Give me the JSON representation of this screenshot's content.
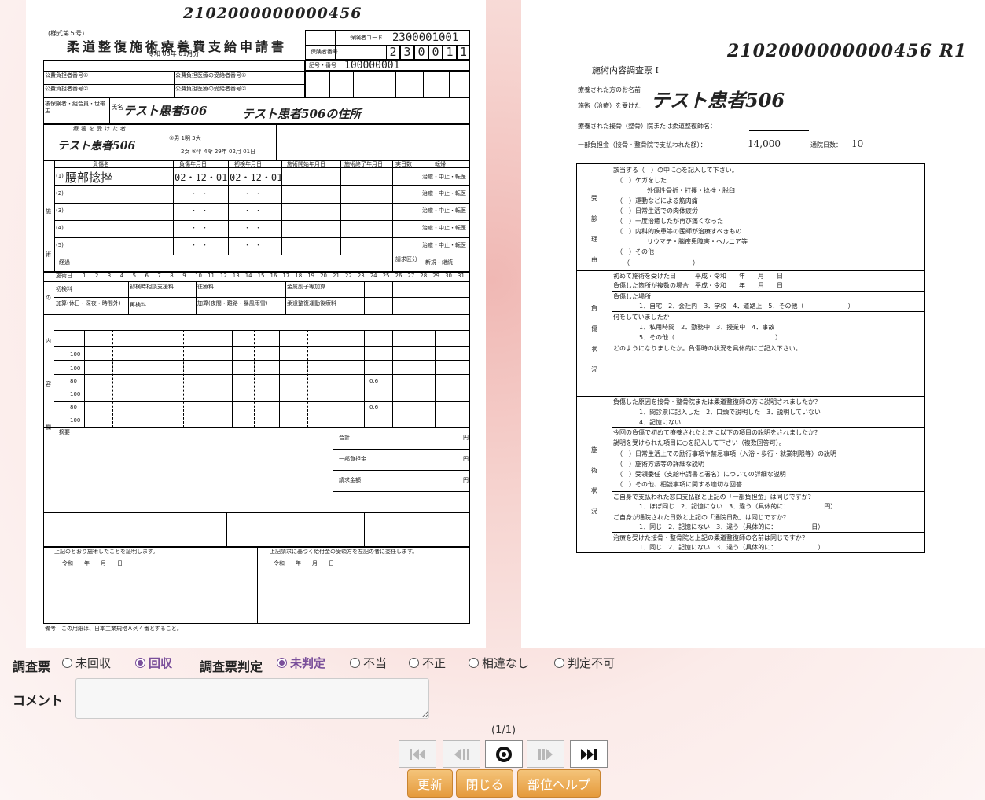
{
  "left_form": {
    "id_number": "2102000000000456",
    "form_no": "(様式第５号)",
    "title": "柔道整復施術療養費支給申請書",
    "era_date": "令和 03年 01月分",
    "insurer_code_label": "保険者コード",
    "insurer_code": "2300001001",
    "insurer_no_label": "保険者番号",
    "insurer_digits": [
      "2",
      "3",
      "0",
      "0",
      "1",
      "1"
    ],
    "symbol_number_label": "記号・番号",
    "symbol_number": "100000001",
    "public1_label": "公費負担者番号①",
    "public2_label": "公費負担者番号②",
    "recipient1_label": "公費負担医療の受給者番号①",
    "recipient2_label": "公費負担医療の受給者番号②",
    "insured_label": "被保険者・組合員・世帯主",
    "name_label": "氏名",
    "insured_name": "テスト患者506",
    "address_value": "テスト患者506の住所",
    "address_label": "住所",
    "patient_label": "療養を受けた者",
    "patient_name": "テスト患者506",
    "sex_label": "②男 1明 3大",
    "birth_text": "2女 ⑤平 4令 29年 02月 01日",
    "injury_header": [
      "負傷名",
      "負傷年月日",
      "初検年月日",
      "施術開始年月日",
      "施術終了年月日",
      "実日数",
      "転帰"
    ],
    "injury_rows": [
      {
        "no": "(1)",
        "name": "腰部捻挫",
        "injury_date": "02・12・01",
        "first_date": "02・12・01",
        "outcome": "治癒・中止・転医"
      },
      {
        "no": "(2)",
        "name": "",
        "injury_date": "・　・",
        "first_date": "・　・",
        "outcome": "治癒・中止・転医"
      },
      {
        "no": "(3)",
        "name": "",
        "injury_date": "・　・",
        "first_date": "・　・",
        "outcome": "治癒・中止・転医"
      },
      {
        "no": "(4)",
        "name": "",
        "injury_date": "・　・",
        "first_date": "・　・",
        "outcome": "治癒・中止・転医"
      },
      {
        "no": "(5)",
        "name": "",
        "injury_date": "・　・",
        "first_date": "・　・",
        "outcome": "治癒・中止・転医"
      }
    ],
    "progress_label": "経過",
    "claim_type_label": "請求区分",
    "claim_type_value": "新規・継続",
    "side_labels": [
      "施",
      "術",
      "の",
      "内",
      "容",
      "欄"
    ],
    "day_label": "施術日",
    "days": [
      "1",
      "2",
      "3",
      "4",
      "5",
      "6",
      "7",
      "8",
      "9",
      "10",
      "11",
      "12",
      "13",
      "14",
      "15",
      "16",
      "17",
      "18",
      "19",
      "20",
      "21",
      "22",
      "23",
      "24",
      "25",
      "26",
      "27",
      "28",
      "29",
      "30",
      "31"
    ],
    "fee_labels": [
      "初検料",
      "初検時相談支援料",
      "往療料",
      "金属副子等加算",
      "加算(休日・深夜・時間外)",
      "再検料",
      "加算(夜間・難路・暴風雨雪)",
      "柔道整復運動後療料"
    ],
    "unit": "円",
    "total_label": "合計",
    "copay_label": "一部負担金",
    "claim_amount_label": "請求金額",
    "summary_label": "摘要",
    "pct_values": [
      "100",
      "100",
      "80",
      "100",
      "80",
      "100"
    ],
    "multi_values": [
      "0.6",
      "0.6"
    ],
    "declaration": "上記のとおり施術したことを証明します。",
    "date_line": "令和　　年　　月　　日",
    "proxy_text": "上記請求に基づく給付金の受領方を左記の者に委任します。",
    "footer": "備考　この用紙は、日本工業規格Ａ列４番とすること。"
  },
  "right_form": {
    "id_number": "2102000000000456 R1",
    "title": "施術内容調査票 I",
    "patient_name_label": "療養された方のお名前",
    "treatment_label": "施術（治療）を受けた",
    "patient_name": "テスト患者506",
    "clinic_label": "療養された接骨（整骨）院または柔道整復師名：",
    "copay_label": "一部負担金（接骨・整骨院で支払われた額）：",
    "copay_value": "14,000",
    "visits_label": "通院日数：",
    "visits_value": "10",
    "section_reason": "受診理由",
    "section_injury": "負傷状況",
    "section_treat": "施術状況",
    "reason_lines": [
      "該当する（　）の中に○を記入して下さい。",
      "（　）ケガをした",
      "外傷性骨折・打撲・捻挫・脱臼",
      "（　）運動などによる筋肉痛",
      "（　）日常生活での肉体疲労",
      "（　）一度治癒したが再び痛くなった",
      "（　）内科的疾患等の医師が治療すべきもの",
      "リウマチ・脳疾患障害・ヘルニア等",
      "（　）その他",
      "（　　　　　　　　　　）"
    ],
    "injury_lines": [
      "初めて施術を受けた日　　　平成・令和　　年　　月　　日",
      "負傷した箇所が複数の場合　平成・令和　　年　　月　　日",
      "負傷した場所",
      "1．自宅　2．会社内　3．学校　4．道路上　5．その他（　　　　　　　）",
      "何をしていましたか",
      "1．私用時間　2．勤務中　3．授業中　4．事故",
      "5．その他（　　　　　　　　　　　　　　　　）",
      "どのようになりましたか。負傷時の状況を具体的にご記入下さい。"
    ],
    "treat_lines": [
      "負傷した原因を接骨・整骨院または柔道整復師の方に説明されましたか？",
      "1．問診票に記入した　2．口頭で説明した　3．説明していない",
      "4．記憶にない",
      "今回の負傷で初めて療養されたときに以下の項目の説明をされましたか？",
      "説明を受けられた項目に○を記入して下さい（複数回答可）。",
      "（　）日常生活上での励行事項や禁忌事項（入浴・歩行・就業制限等）の説明",
      "（　）施術方法等の詳細な説明",
      "（　）受領委任（支給申請書と署名）についての詳細な説明",
      "（　）その他、相談事項に関する適切な回答",
      "ご自身で支払われた窓口支払額と上記の「一部負担金」は同じですか？",
      "1．ほぼ同じ　2．記憶にない　3．違う（具体的に：　　　　　　円）",
      "ご自身が通院された日数と上記の「通院日数」は同じですか？",
      "1．同じ　2．記憶にない　3．違う（具体的に：　　　　　　日）",
      "治療を受けた接骨・整骨院と上記の柔道整復師の名前は同じですか？",
      "1．同じ　2．記憶にない　3．違う（具体的に：　　　　　　　）"
    ]
  },
  "controls": {
    "survey_label": "調査票",
    "survey_options": [
      {
        "label": "未回収",
        "checked": false
      },
      {
        "label": "回収",
        "checked": true
      }
    ],
    "judgment_label": "調査票判定",
    "judgment_options": [
      {
        "label": "未判定",
        "checked": true
      },
      {
        "label": "不当",
        "checked": false
      },
      {
        "label": "不正",
        "checked": false
      },
      {
        "label": "相違なし",
        "checked": false
      },
      {
        "label": "判定不可",
        "checked": false
      }
    ],
    "comment_label": "コメント",
    "comment_value": "",
    "page_indicator": "(1/1)",
    "buttons": {
      "refresh": "更新",
      "close": "閉じる",
      "help": "部位ヘルプ"
    }
  }
}
